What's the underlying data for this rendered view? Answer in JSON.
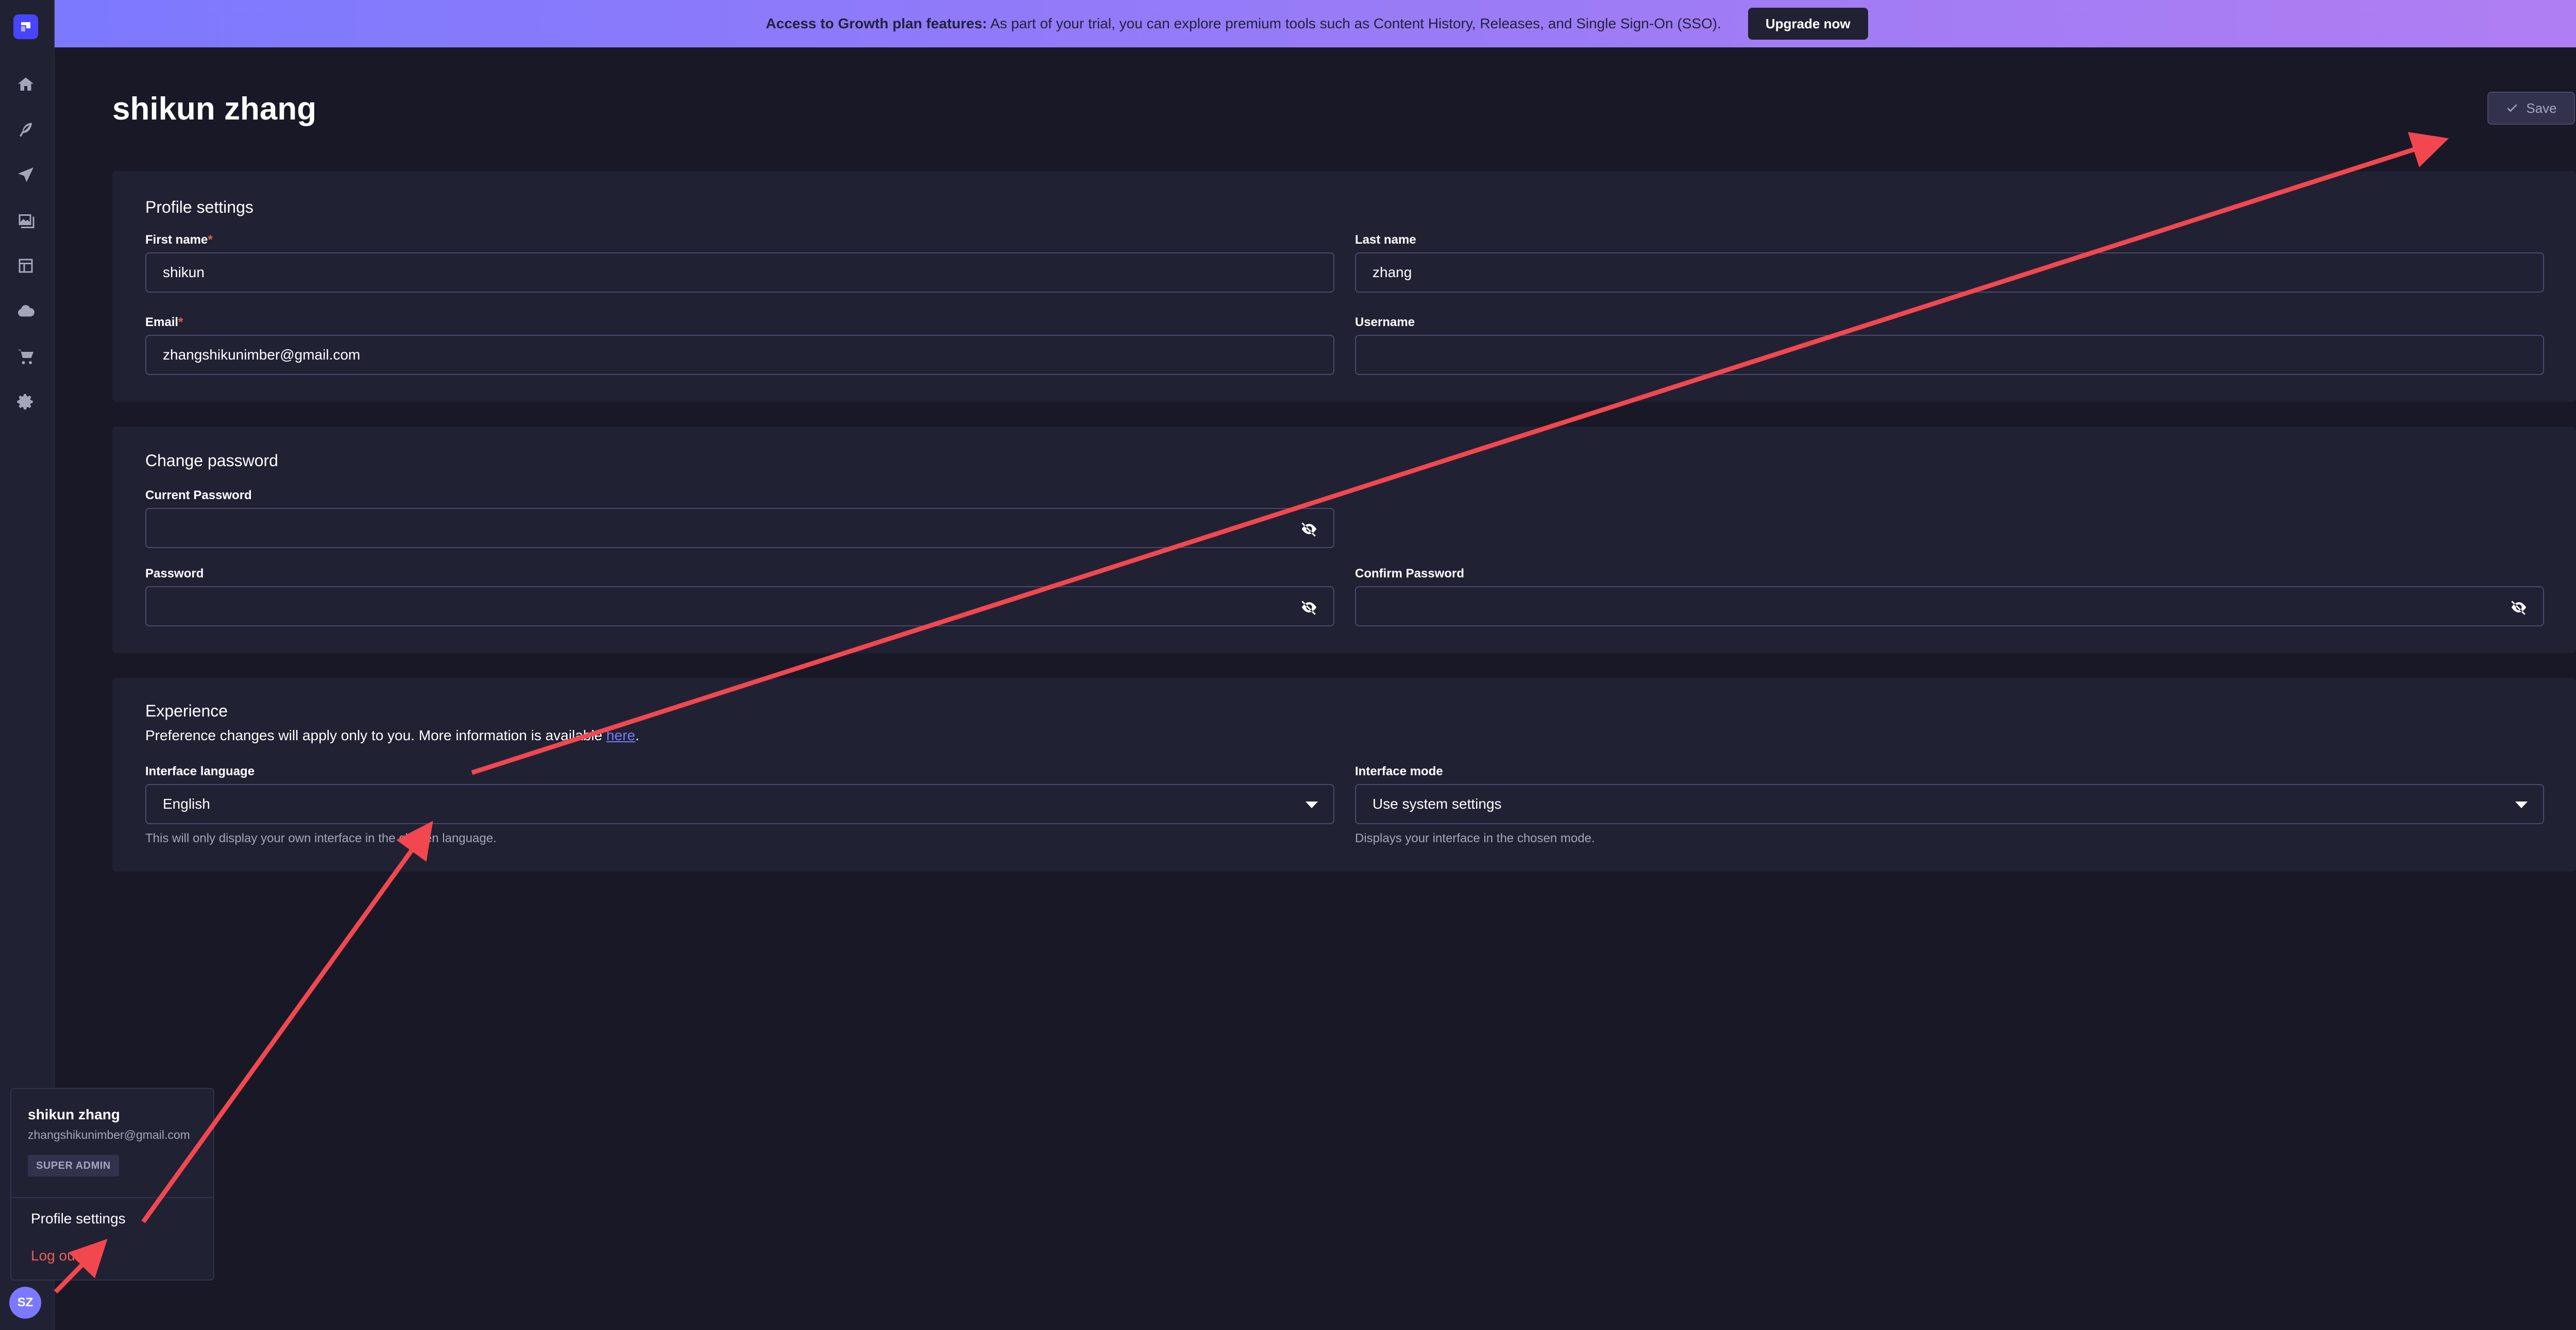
{
  "banner": {
    "bold_text": "Access to Growth plan features:",
    "text": "As part of your trial, you can explore premium tools such as Content History, Releases, and Single Sign-On (SSO).",
    "button_label": "Upgrade now"
  },
  "sidebar": {
    "items": [
      {
        "icon": "home-icon"
      },
      {
        "icon": "feather-icon"
      },
      {
        "icon": "paper-plane-icon"
      },
      {
        "icon": "images-icon"
      },
      {
        "icon": "layout-icon"
      },
      {
        "icon": "cloud-icon"
      },
      {
        "icon": "cart-icon"
      },
      {
        "icon": "gear-icon"
      }
    ],
    "avatar_initials": "SZ"
  },
  "page": {
    "title": "shikun zhang",
    "save_label": "Save"
  },
  "profile": {
    "title": "Profile settings",
    "first_name_label": "First name",
    "first_name_value": "shikun",
    "last_name_label": "Last name",
    "last_name_value": "zhang",
    "email_label": "Email",
    "email_value": "zhangshikunimber@gmail.com",
    "username_label": "Username",
    "username_value": "",
    "required_mark": "*"
  },
  "password": {
    "title": "Change password",
    "current_label": "Current Password",
    "password_label": "Password",
    "confirm_label": "Confirm Password"
  },
  "experience": {
    "title": "Experience",
    "description": "Preference changes will apply only to you. More information is available",
    "link_text": "here",
    "period": ".",
    "language_label": "Interface language",
    "language_value": "English",
    "language_hint": "This will only display your own interface in the chosen language.",
    "mode_label": "Interface mode",
    "mode_value": "Use system settings",
    "mode_hint": "Displays your interface in the chosen mode."
  },
  "user_menu": {
    "name": "shikun zhang",
    "email": "zhangshikunimber@gmail.com",
    "role_badge": "SUPER ADMIN",
    "profile_settings": "Profile settings",
    "logout": "Log out"
  },
  "colors": {
    "background": "#181826",
    "card": "#212134",
    "accent": "#7b79ff",
    "danger": "#ee5e52",
    "annotation_arrow": "#f2474f"
  }
}
